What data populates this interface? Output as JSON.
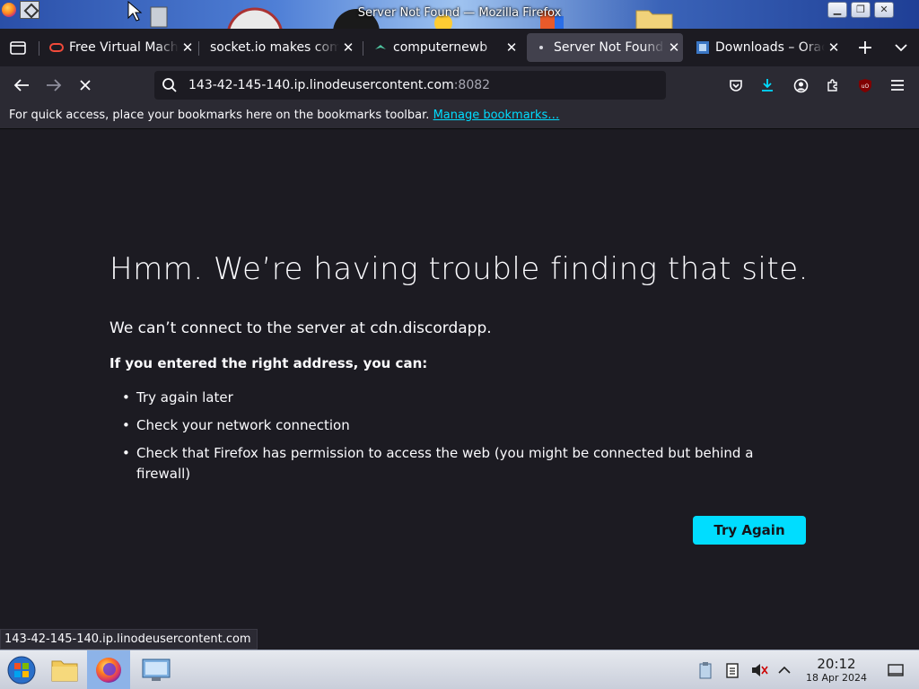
{
  "window": {
    "title": "Server Not Found — Mozilla Firefox"
  },
  "tabs": [
    {
      "label": "Free Virtual Machines",
      "favicon": "oracle-ring-icon",
      "active": false
    },
    {
      "label": "socket.io makes comp",
      "favicon": "",
      "active": false
    },
    {
      "label": "computernewb",
      "favicon": "computernewb-icon",
      "active": false
    },
    {
      "label": "Server Not Found",
      "favicon": "dot-icon",
      "active": true
    },
    {
      "label": "Downloads – Oracle",
      "favicon": "downloads-page-icon",
      "active": false
    }
  ],
  "navbar": {
    "url_host": "143-42-145-140.ip.linodeusercontent.com",
    "url_port": ":8082"
  },
  "bookmarks_bar": {
    "message": "For quick access, place your bookmarks here on the bookmarks toolbar.",
    "link": "Manage bookmarks…"
  },
  "error_page": {
    "title": "Hmm. We’re having trouble finding that site.",
    "description": "We can’t connect to the server at cdn.discordapp.",
    "hint": "If you entered the right address, you can:",
    "suggestions": [
      "Try again later",
      "Check your network connection",
      "Check that Firefox has permission to access the web (you might be connected but behind a firewall)"
    ],
    "button_label": "Try Again",
    "accent_color": "#00ddff"
  },
  "status_text": "143-42-145-140.ip.linodeusercontent.com",
  "taskbar": {
    "time": "20:12",
    "date": "18 Apr 2024"
  }
}
